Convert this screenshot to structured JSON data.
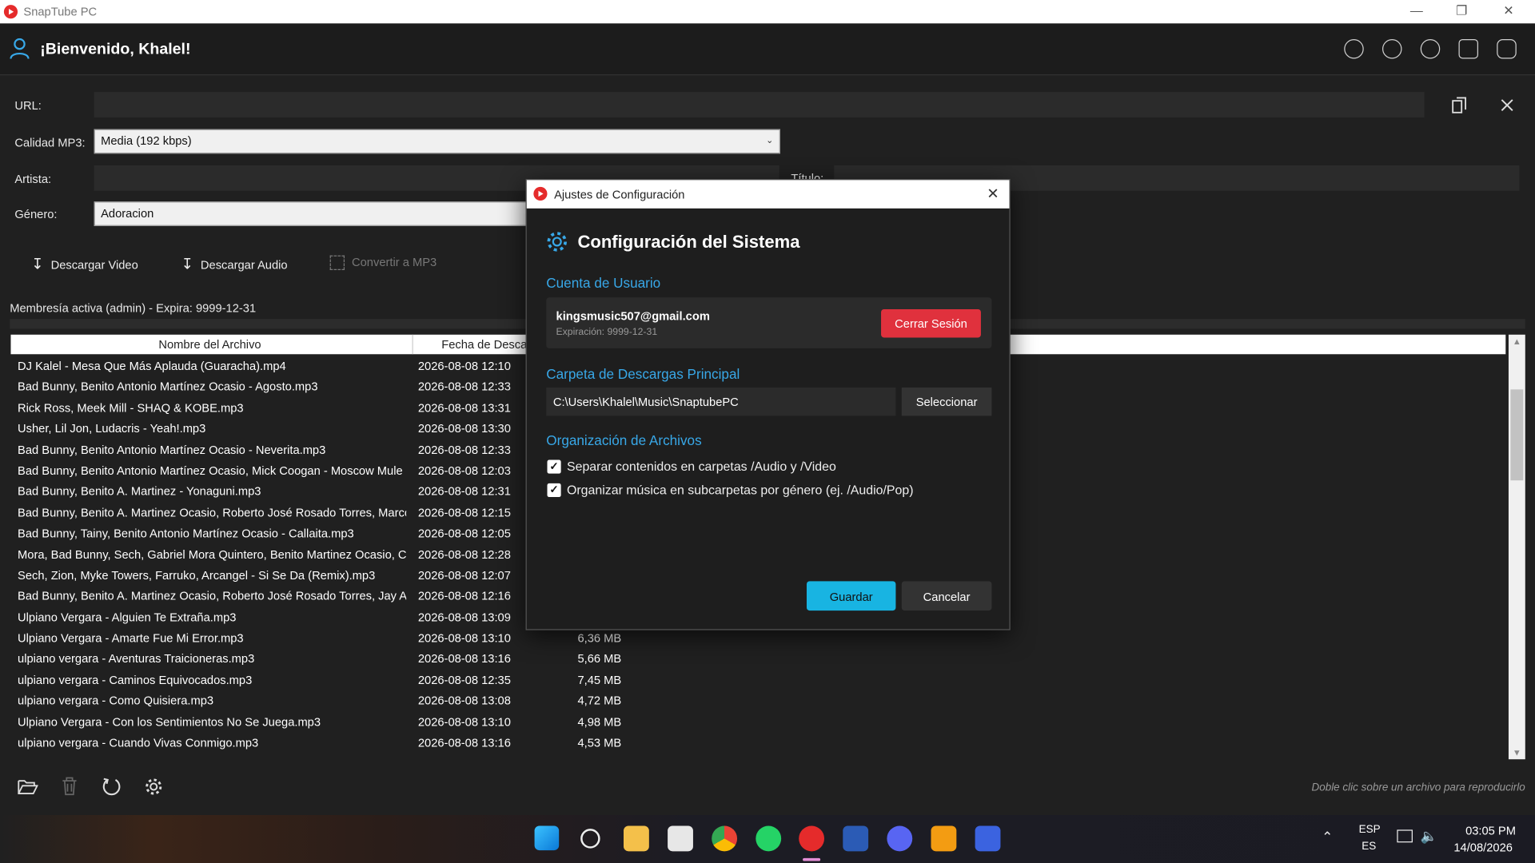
{
  "window": {
    "title": "SnapTube PC"
  },
  "header": {
    "welcome": "¡Bienvenido, Khalel!"
  },
  "form": {
    "url_label": "URL:",
    "url_value": "",
    "quality_label": "Calidad MP3:",
    "quality_value": "Media (192 kbps)",
    "artist_label": "Artista:",
    "title_label": "Título:",
    "genre_label": "Género:",
    "genre_value": "Adoracion"
  },
  "actions": {
    "download_video": "Descargar Video",
    "download_audio": "Descargar Audio",
    "convert_mp3": "Convertir a MP3"
  },
  "membership": "Membresía activa (admin) - Expira: 9999-12-31",
  "table": {
    "columns": [
      "Nombre del Archivo",
      "Fecha de Descarga"
    ],
    "rows": [
      {
        "name": "DJ Kalel - Mesa Que Más Aplauda (Guaracha).mp4",
        "date": "2026-08-08 12:10",
        "size": ""
      },
      {
        "name": "Bad Bunny, Benito Antonio Martínez Ocasio - Agosto.mp3",
        "date": "2026-08-08 12:33",
        "size": ""
      },
      {
        "name": "Rick Ross, Meek Mill - SHAQ & KOBE.mp3",
        "date": "2026-08-08 13:31",
        "size": ""
      },
      {
        "name": "Usher, Lil Jon, Ludacris - Yeah!.mp3",
        "date": "2026-08-08 13:30",
        "size": ""
      },
      {
        "name": "Bad Bunny, Benito Antonio Martínez Ocasio - Neverita.mp3",
        "date": "2026-08-08 12:33",
        "size": ""
      },
      {
        "name": "Bad Bunny, Benito Antonio Martínez Ocasio, Mick Coogan - Moscow Mule",
        "date": "2026-08-08 12:03",
        "size": ""
      },
      {
        "name": "Bad Bunny, Benito A. Martinez - Yonaguni.mp3",
        "date": "2026-08-08 12:31",
        "size": ""
      },
      {
        "name": "Bad Bunny, Benito A. Martinez Ocasio, Roberto José Rosado Torres, Marco",
        "date": "2026-08-08 12:15",
        "size": ""
      },
      {
        "name": "Bad Bunny, Tainy, Benito Antonio Martínez Ocasio - Callaita.mp3",
        "date": "2026-08-08 12:05",
        "size": ""
      },
      {
        "name": "Mora, Bad Bunny, Sech, Gabriel Mora Quintero, Benito Martinez Ocasio, C",
        "date": "2026-08-08 12:28",
        "size": ""
      },
      {
        "name": "Sech, Zion, Myke Towers, Farruko, Arcangel - Si Se Da (Remix).mp3",
        "date": "2026-08-08 12:07",
        "size": ""
      },
      {
        "name": "Bad Bunny, Benito A. Martinez Ocasio, Roberto José Rosado Torres, Jay Ar",
        "date": "2026-08-08 12:16",
        "size": ""
      },
      {
        "name": "Ulpiano Vergara - Alguien Te Extraña.mp3",
        "date": "2026-08-08 13:09",
        "size": ""
      },
      {
        "name": "Ulpiano Vergara - Amarte Fue Mi Error.mp3",
        "date": "2026-08-08 13:10",
        "size": "6,36 MB"
      },
      {
        "name": "ulpiano vergara - Aventuras Traicioneras.mp3",
        "date": "2026-08-08 13:16",
        "size": "5,66 MB"
      },
      {
        "name": "ulpiano vergara - Caminos Equivocados.mp3",
        "date": "2026-08-08 12:35",
        "size": "7,45 MB"
      },
      {
        "name": "ulpiano vergara - Como Quisiera.mp3",
        "date": "2026-08-08 13:08",
        "size": "4,72 MB"
      },
      {
        "name": "Ulpiano Vergara - Con los Sentimientos No Se Juega.mp3",
        "date": "2026-08-08 13:10",
        "size": "4,98 MB"
      },
      {
        "name": "ulpiano vergara - Cuando Vivas Conmigo.mp3",
        "date": "2026-08-08 13:16",
        "size": "4,53 MB"
      }
    ]
  },
  "footer_hint": "Doble clic sobre un archivo para reproducirlo",
  "modal": {
    "window_title": "Ajustes de Configuración",
    "heading": "Configuración del Sistema",
    "account_section": "Cuenta de Usuario",
    "email": "kingsmusic507@gmail.com",
    "expiration": "Expiración: 9999-12-31",
    "logout": "Cerrar Sesión",
    "folder_section": "Carpeta de Descargas Principal",
    "folder_path": "C:\\Users\\Khalel\\Music\\SnaptubePC",
    "select": "Seleccionar",
    "org_section": "Organización de Archivos",
    "opt1": "Separar contenidos en carpetas /Audio y /Video",
    "opt2": "Organizar música en subcarpetas por género (ej. /Audio/Pop)",
    "save": "Guardar",
    "cancel": "Cancelar"
  },
  "taskbar": {
    "lang": "ESP",
    "lang2": "ES",
    "time": "03:05 PM",
    "date": "14/08/2026"
  },
  "colors": {
    "accent": "#38a8e8",
    "danger": "#e0313d",
    "primary": "#18b4e2"
  }
}
